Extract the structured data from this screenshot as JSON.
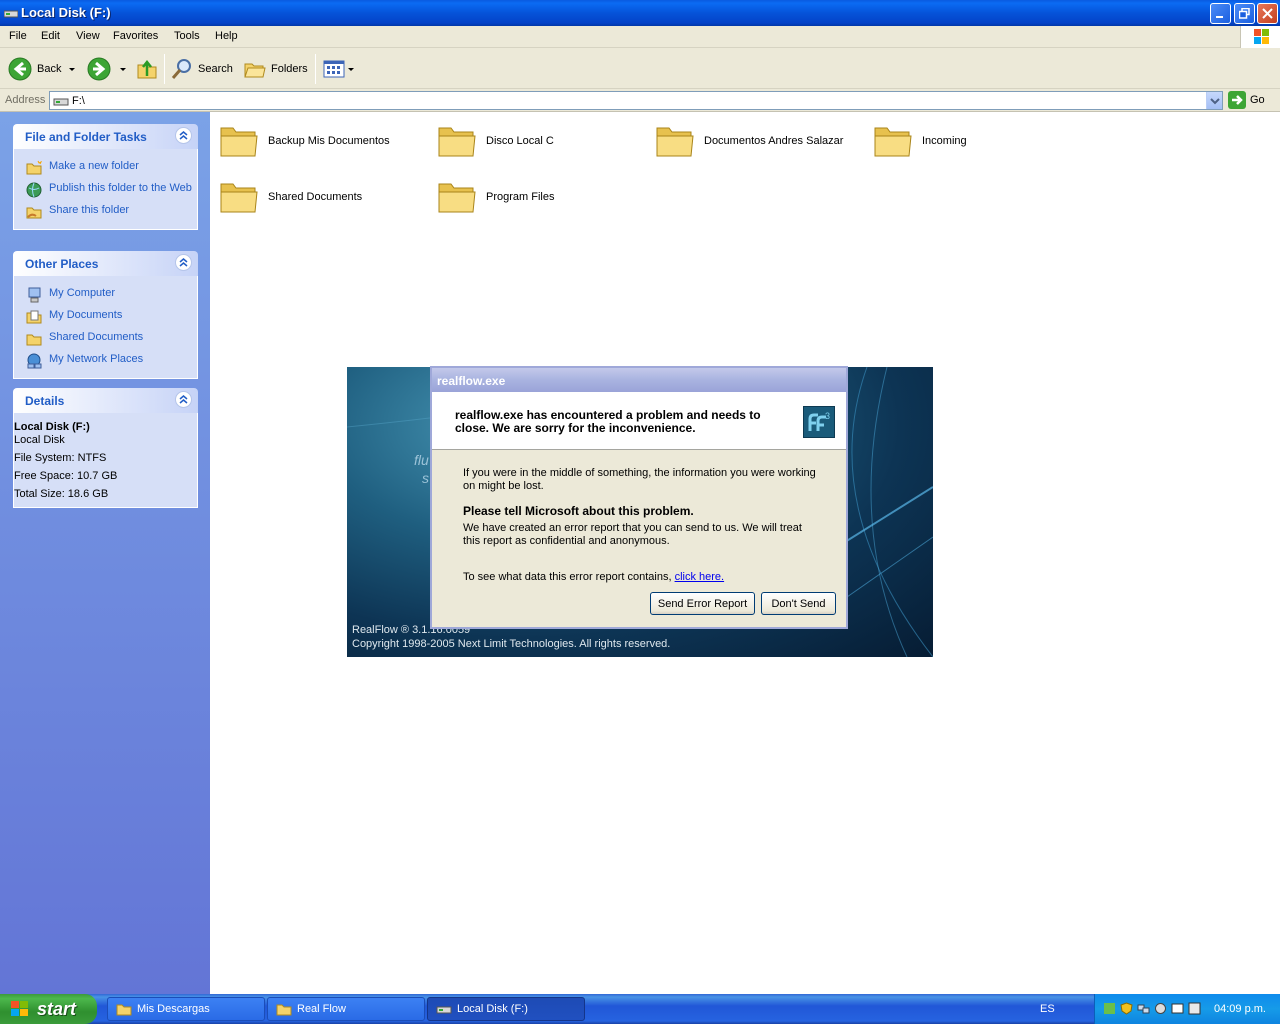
{
  "window": {
    "title": "Local Disk (F:)"
  },
  "menu": [
    "File",
    "Edit",
    "View",
    "Favorites",
    "Tools",
    "Help"
  ],
  "toolbar": {
    "back": "Back",
    "search": "Search",
    "folders": "Folders"
  },
  "address": {
    "label": "Address",
    "value": "F:\\",
    "go": "Go"
  },
  "taskpane": {
    "file_tasks": {
      "title": "File and Folder Tasks",
      "items": [
        "Make a new folder",
        "Publish this folder to the Web",
        "Share this folder"
      ]
    },
    "other_places": {
      "title": "Other Places",
      "items": [
        "My Computer",
        "My Documents",
        "Shared Documents",
        "My Network Places"
      ]
    },
    "details": {
      "title": "Details",
      "name": "Local Disk (F:)",
      "type": "Local Disk",
      "fs": "File System: NTFS",
      "free": "Free Space: 10.7 GB",
      "total": "Total Size: 18.6 GB"
    }
  },
  "folders": [
    "Backup Mis Documentos",
    "Disco Local C",
    "Documentos Andres Salazar",
    "Incoming",
    "Shared Documents",
    "Program Files"
  ],
  "splash": {
    "version": "RealFlow ® 3.1.16.0059",
    "copyright": "Copyright 1998-2005 Next Limit Technologies. All rights reserved.",
    "ghost1": "flu",
    "ghost2": "s"
  },
  "dialog": {
    "title": "realflow.exe",
    "header": "realflow.exe has encountered a problem and needs to close.  We are sorry for the inconvenience.",
    "p1": "If you were in the middle of something, the information you were working on might be lost.",
    "bold": "Please tell Microsoft about this problem.",
    "p2": "We have created an error report that you can send to us.  We will treat this report as confidential and anonymous.",
    "p3": "To see what data this error report contains,",
    "link": "click here.",
    "send": "Send Error Report",
    "dont": "Don't Send"
  },
  "taskbar": {
    "start": "start",
    "buttons": [
      "Mis Descargas",
      "Real Flow",
      "Local Disk (F:)"
    ],
    "lang": "ES",
    "clock": "04:09 p.m."
  },
  "colors": {
    "titlebar": "#0553d9",
    "taskpane": "#7ba2e7",
    "link": "#215dc6",
    "start": "#3c9a3c"
  }
}
